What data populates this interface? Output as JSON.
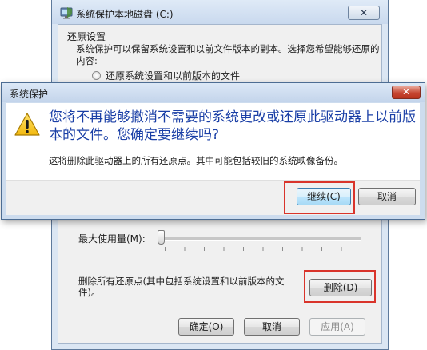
{
  "background_dialog": {
    "title": "系统保护本地磁盘 (C:)",
    "close_label": "✕",
    "section_title": "还原设置",
    "description": "系统保护可以保留系统设置和以前文件版本的副本。选择您希望能够还原的内容:",
    "radio_restore_label": "还原系统设置和以前版本的文件",
    "max_usage_label": "最大使用量(M):",
    "max_usage_level_percent": 0,
    "delete_description": "删除所有还原点(其中包括系统设置和以前版本的文件)。",
    "delete_button": "删除(D)",
    "ok_button": "确定(O)",
    "cancel_button": "取消",
    "apply_button": "应用(A)"
  },
  "confirm_dialog": {
    "title": "系统保护",
    "close_label": "✕",
    "headline": "您将不再能够撤消不需要的系统更改或还原此驱动器上以前版本的文件。您确定要继续吗?",
    "detail": "这将删除此驱动器上的所有还原点。其中可能包括较旧的系统映像备份。",
    "continue_button": "继续(C)",
    "cancel_button": "取消"
  },
  "colors": {
    "highlight": "#d9342b",
    "headline": "#1a3fa6",
    "title_close": "#c74733"
  },
  "icons": {
    "warning": "warning-icon",
    "app": "system-protection-icon"
  }
}
